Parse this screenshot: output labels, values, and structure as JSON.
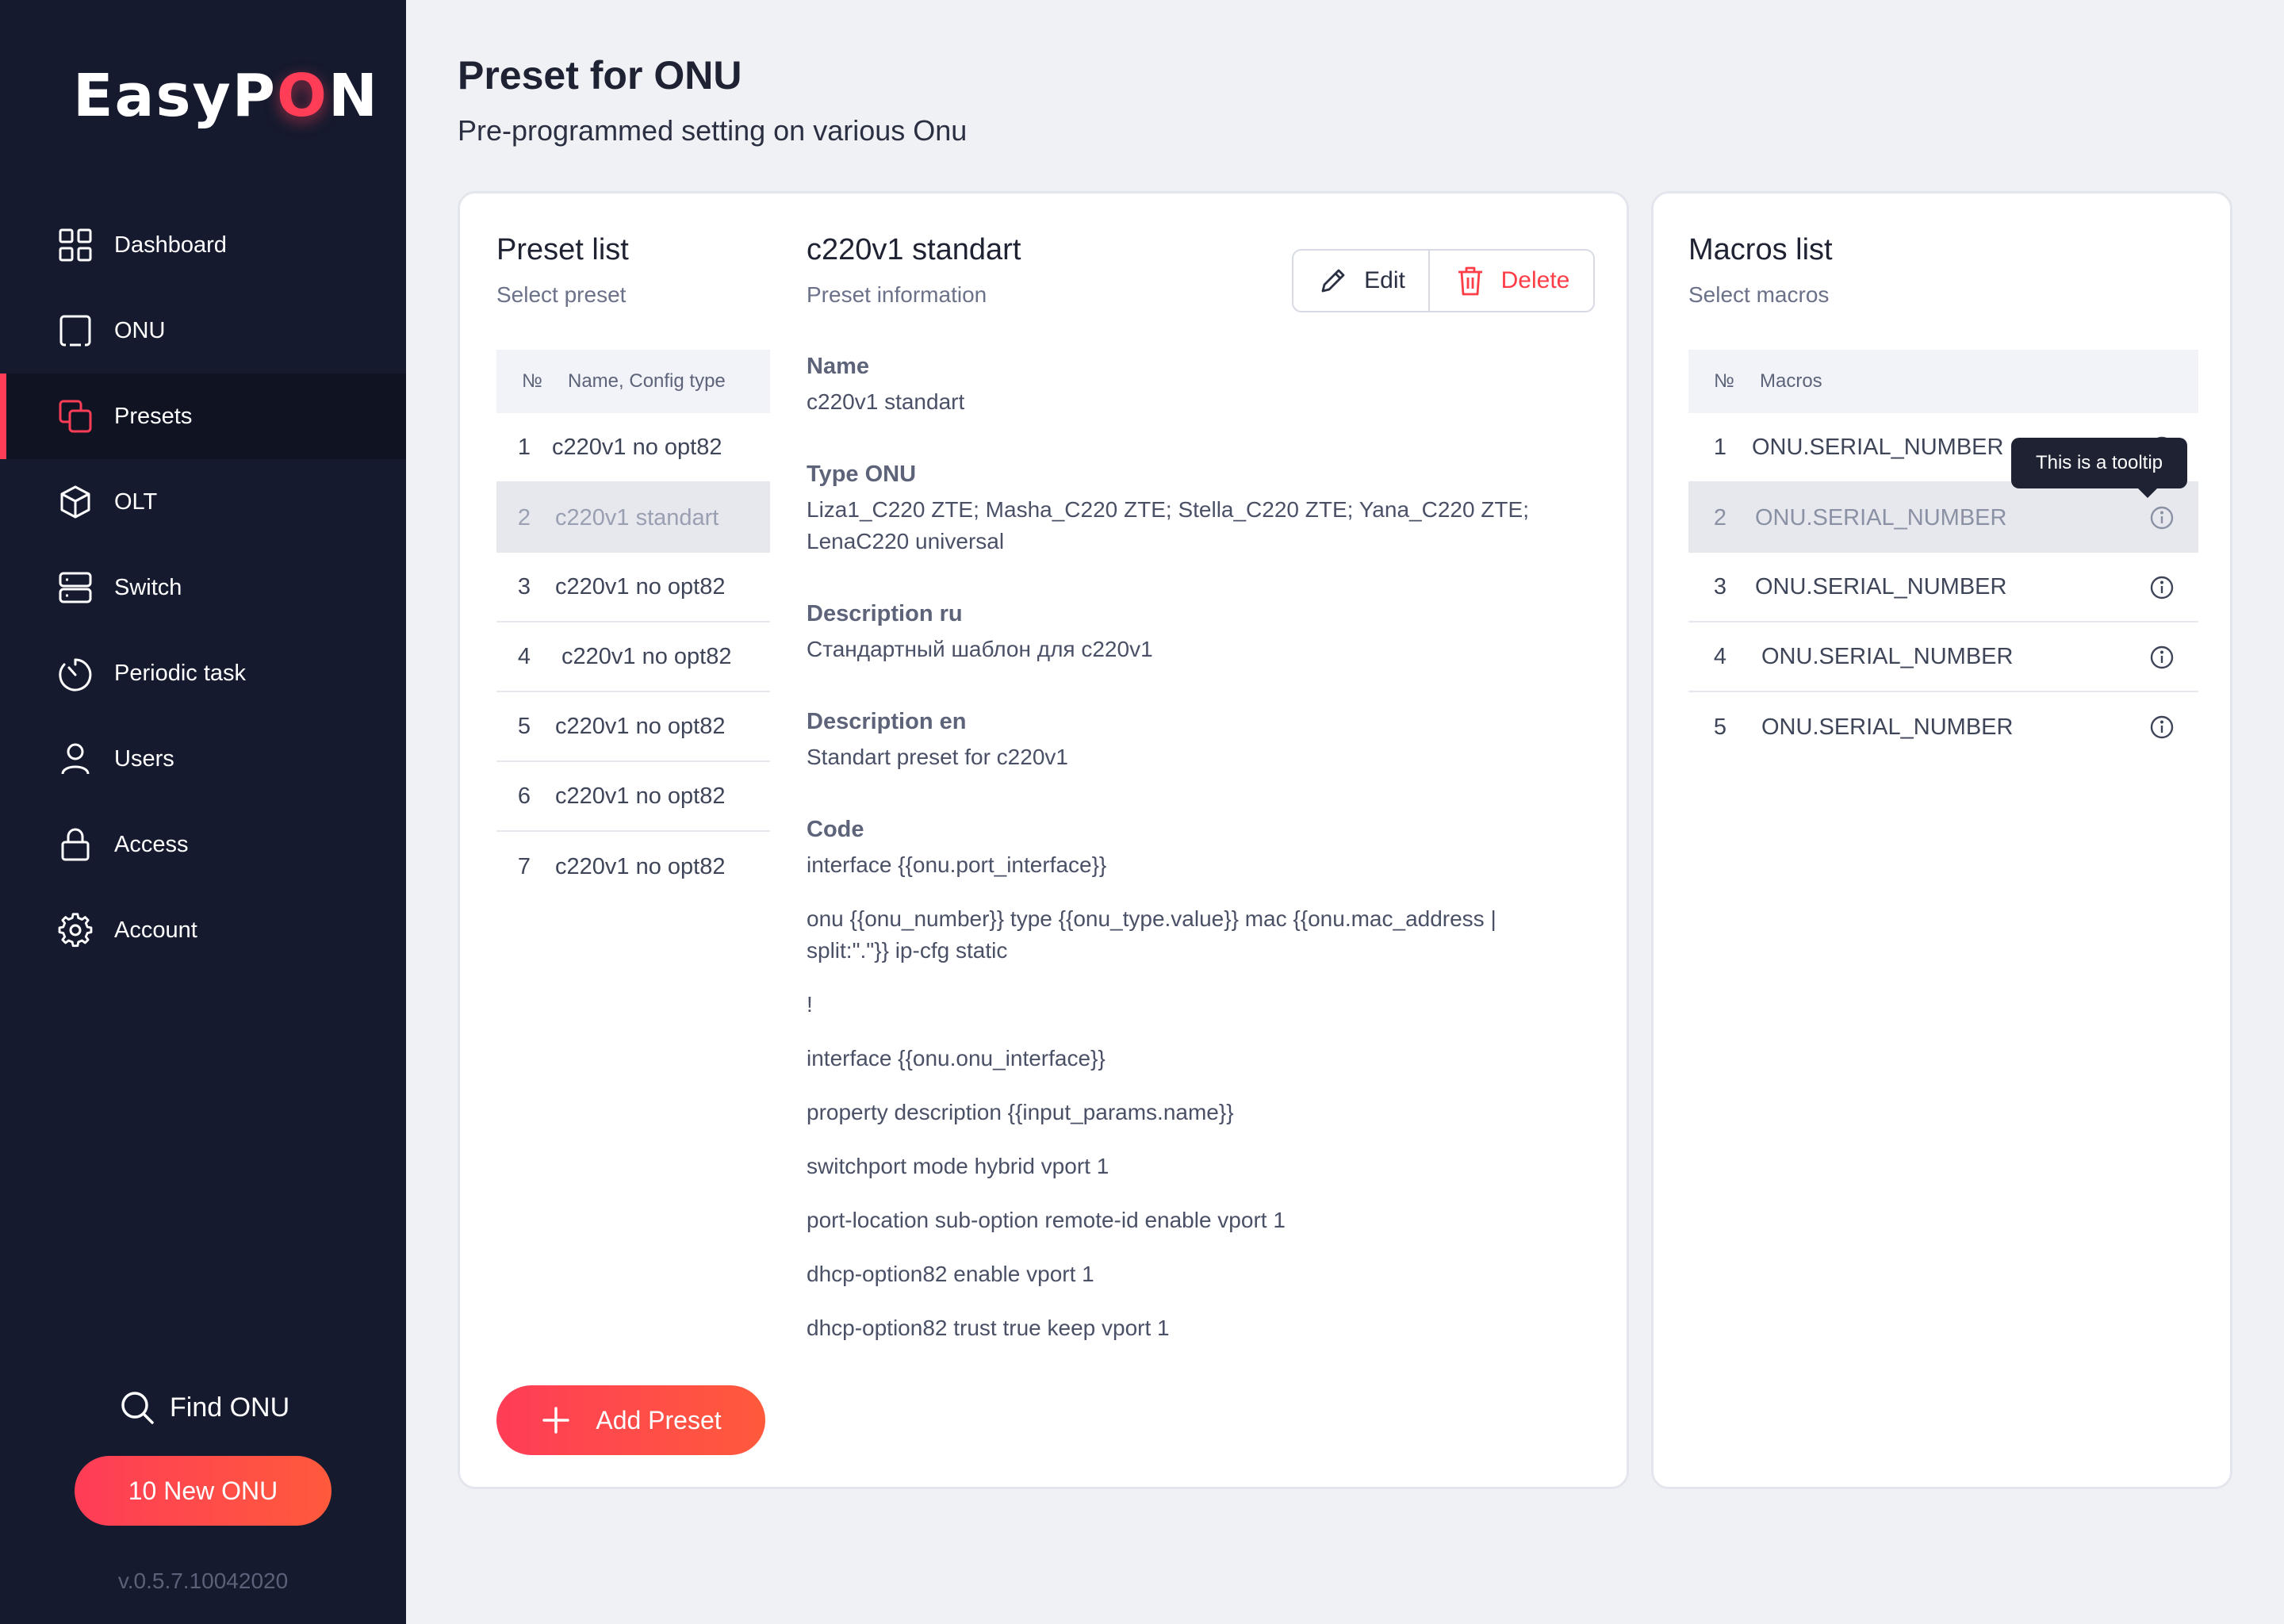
{
  "app": {
    "logo_prefix": "EasyP",
    "logo_o": "O",
    "logo_suffix": "N",
    "version": "v.0.5.7.10042020"
  },
  "sidebar": {
    "items": [
      {
        "label": "Dashboard",
        "icon": "dashboard-grid-icon"
      },
      {
        "label": "ONU",
        "icon": "onu-square-icon"
      },
      {
        "label": "Presets",
        "icon": "presets-copy-icon",
        "active": true
      },
      {
        "label": "OLT",
        "icon": "cube-icon"
      },
      {
        "label": "Switch",
        "icon": "server-icon"
      },
      {
        "label": "Periodic task",
        "icon": "timer-icon"
      },
      {
        "label": "Users",
        "icon": "user-icon"
      },
      {
        "label": "Access",
        "icon": "lock-icon"
      },
      {
        "label": "Account",
        "icon": "gear-icon"
      }
    ],
    "find_onu": "Find ONU",
    "new_onu": "10 New ONU"
  },
  "header": {
    "title": "Preset for ONU",
    "subtitle": "Pre-programmed setting on various Onu"
  },
  "preset_list": {
    "title": "Preset list",
    "subtitle": "Select preset",
    "col_num": "№",
    "col_name": "Name, Config type",
    "rows": [
      {
        "num": "1",
        "name": "c220v1 no opt82"
      },
      {
        "num": "2",
        "name": "c220v1 standart",
        "selected": true
      },
      {
        "num": "3",
        "name": "c220v1 no opt82"
      },
      {
        "num": "4",
        "name": "c220v1 no opt82"
      },
      {
        "num": "5",
        "name": "c220v1 no opt82"
      },
      {
        "num": "6",
        "name": "c220v1 no opt82"
      },
      {
        "num": "7",
        "name": "c220v1 no opt82"
      }
    ],
    "add_button": "Add Preset"
  },
  "preset_info": {
    "title": "c220v1 standart",
    "subtitle": "Preset information",
    "edit_label": "Edit",
    "delete_label": "Delete",
    "name_label": "Name",
    "name_value": "c220v1 standart",
    "type_label": "Type ONU",
    "type_value_line1": "Liza1_C220 ZTE; Masha_C220 ZTE; Stella_C220 ZTE; Yana_C220 ZTE;",
    "type_value_line2": "LenaC220 universal",
    "desc_ru_label": "Description ru",
    "desc_ru_value": "Стандартный шаблон для c220v1",
    "desc_en_label": "Description en",
    "desc_en_value": "Standart preset for c220v1",
    "code_label": "Code",
    "code_lines": [
      "interface  {{onu.port_interface}}",
      "onu  {{onu_number}}   type  {{onu_type.value}} mac  {{onu.mac_address |",
      "split:\".\"}} ip-cfg static",
      "!",
      "interface  {{onu.onu_interface}}",
      "property description {{input_params.name}}",
      "switchport mode hybrid vport 1",
      "port-location sub-option remote-id enable vport 1",
      "dhcp-option82 enable vport 1",
      "dhcp-option82 trust true keep vport 1"
    ]
  },
  "macros_list": {
    "title": "Macros list",
    "subtitle": "Select macros",
    "col_num": "№",
    "col_name": "Macros",
    "rows": [
      {
        "num": "1",
        "name": "ONU.SERIAL_NUMBER"
      },
      {
        "num": "2",
        "name": "ONU.SERIAL_NUMBER",
        "selected": true
      },
      {
        "num": "3",
        "name": "ONU.SERIAL_NUMBER"
      },
      {
        "num": "4",
        "name": "ONU.SERIAL_NUMBER"
      },
      {
        "num": "5",
        "name": "ONU.SERIAL_NUMBER"
      }
    ],
    "tooltip": "This is a tooltip"
  },
  "colors": {
    "sidebar_bg": "#151a2e",
    "accent": "#ff3d57",
    "danger": "#ff3d47"
  }
}
